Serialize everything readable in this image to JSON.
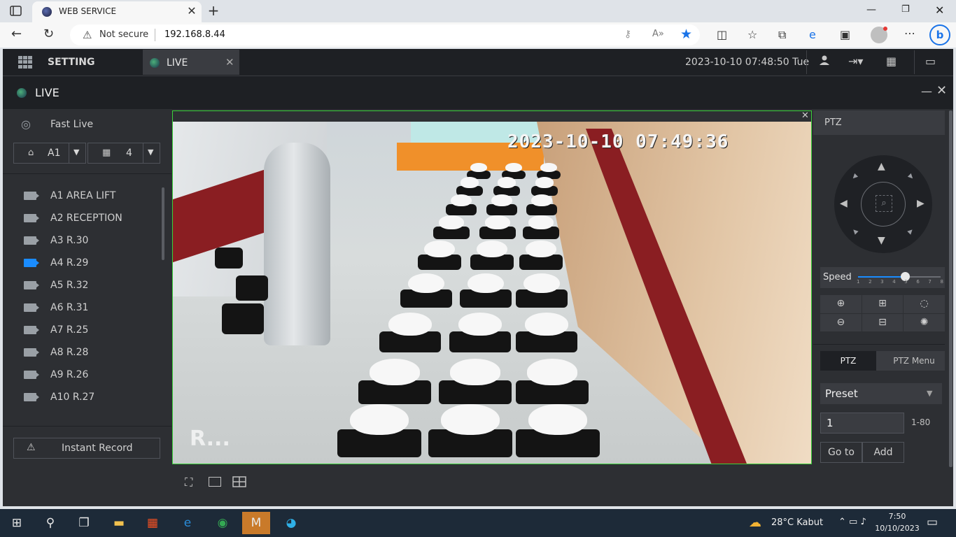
{
  "browser": {
    "tab_title": "WEB SERVICE",
    "tab_close": "✕",
    "new_tab": "+",
    "security_label": "Not secure",
    "url": "192.168.8.44",
    "window_min": "—",
    "window_max": "❐",
    "window_close": "✕",
    "more": "⋯",
    "bing": "b"
  },
  "app": {
    "setting_label": "SETTING",
    "live_tab_label": "LIVE",
    "live_tab_close": "✕",
    "datetime": "2023-10-10 07:48:50 Tue",
    "panel_title": "LIVE",
    "panel_min": "—",
    "panel_close": "✕"
  },
  "sidebar": {
    "fast_live": "Fast Live",
    "group_select": "A1",
    "split_select": "4",
    "cameras": [
      {
        "label": "A1 AREA LIFT",
        "active": false
      },
      {
        "label": "A2 RECEPTION",
        "active": false
      },
      {
        "label": "A3 R.30",
        "active": false
      },
      {
        "label": "A4 R.29",
        "active": true
      },
      {
        "label": "A5 R.32",
        "active": false
      },
      {
        "label": "A6 R.31",
        "active": false
      },
      {
        "label": "A7 R.25",
        "active": false
      },
      {
        "label": "A8 R.28",
        "active": false
      },
      {
        "label": "A9 R.26",
        "active": false
      },
      {
        "label": "A10 R.27",
        "active": false
      }
    ],
    "instant_record": "Instant Record"
  },
  "video": {
    "osd_time": "2023-10-10 07:49:36",
    "osd_name": "R...",
    "close": "✕"
  },
  "ptz": {
    "title": "PTZ",
    "speed_label": "Speed",
    "speed_value": 5,
    "speed_ticks": [
      "1",
      "2",
      "3",
      "4",
      "5",
      "6",
      "7",
      "8"
    ],
    "tab_ptz": "PTZ",
    "tab_ptz_menu": "PTZ Menu",
    "preset_label": "Preset",
    "preset_value": "1",
    "preset_range": "1-80",
    "goto_label": "Go to",
    "add_label": "Add"
  },
  "taskbar": {
    "weather": "28°C  Kabut",
    "time": "7:50",
    "date": "10/10/2023"
  },
  "colors": {
    "accent": "#1a8cff",
    "video_border": "#3ad13a",
    "header_bg": "#1e2024",
    "panel_bg": "#2d2f33"
  }
}
